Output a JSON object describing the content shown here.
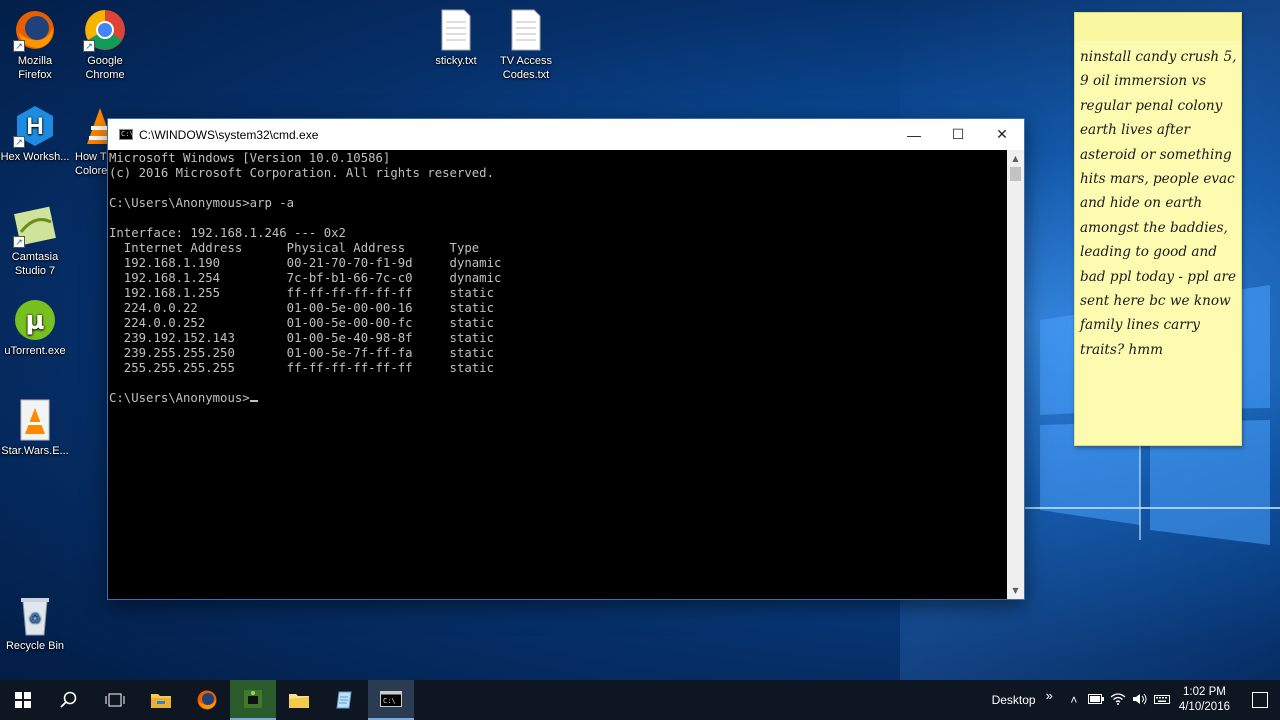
{
  "desktop_icons": [
    {
      "label": "Mozilla Firefox",
      "icon": "firefox-icon"
    },
    {
      "label": "Google Chrome",
      "icon": "chrome-icon"
    },
    {
      "label": "Hex Worksh...",
      "icon": "hex-workshop-icon"
    },
    {
      "label": "How T Colore",
      "icon": "vlc-icon"
    },
    {
      "label": "Camtasia Studio 7",
      "icon": "camtasia-icon"
    },
    {
      "label": "uTorrent.exe",
      "icon": "utorrent-icon"
    },
    {
      "label": "Star.Wars.E...",
      "icon": "vlc-file-icon"
    },
    {
      "label": "Recycle Bin",
      "icon": "recycle-bin-icon"
    },
    {
      "label": "sticky.txt",
      "icon": "text-file-icon"
    },
    {
      "label": "TV Access Codes.txt",
      "icon": "text-file-icon"
    }
  ],
  "cmd": {
    "title": "C:\\WINDOWS\\system32\\cmd.exe",
    "controls": {
      "minimize": "—",
      "maximize": "☐",
      "close": "✕"
    },
    "lines": [
      "Microsoft Windows [Version 10.0.10586]",
      "(c) 2016 Microsoft Corporation. All rights reserved.",
      "",
      "C:\\Users\\Anonymous>arp -a",
      "",
      "Interface: 192.168.1.246 --- 0x2",
      "  Internet Address      Physical Address      Type",
      "  192.168.1.190         00-21-70-70-f1-9d     dynamic",
      "  192.168.1.254         7c-bf-b1-66-7c-c0     dynamic",
      "  192.168.1.255         ff-ff-ff-ff-ff-ff     static",
      "  224.0.0.22            01-00-5e-00-00-16     static",
      "  224.0.0.252           01-00-5e-00-00-fc     static",
      "  239.192.152.143       01-00-5e-40-98-8f     static",
      "  239.255.255.250       01-00-5e-7f-ff-fa     static",
      "  255.255.255.255       ff-ff-ff-ff-ff-ff     static",
      ""
    ],
    "prompt": "C:\\Users\\Anonymous>"
  },
  "sticky": {
    "text": "ninstall candy crush 5, 9\noil immersion vs regular\npenal colony earth lives after asteroid or something hits mars, people evac and hide on earth amongst the baddies, leading to good and bad ppl today - ppl are sent here bc we know family lines carry traits? hmm"
  },
  "taskbar": {
    "buttons": [
      "start-icon",
      "search-icon",
      "task-view-icon",
      "file-explorer-icon",
      "firefox-icon",
      "camtasia-icon",
      "folder-icon",
      "notepad-icon",
      "cmd-icon"
    ],
    "desktop_label": "Desktop",
    "chevron": "»",
    "time": "1:02 PM",
    "date": "4/10/2016"
  }
}
